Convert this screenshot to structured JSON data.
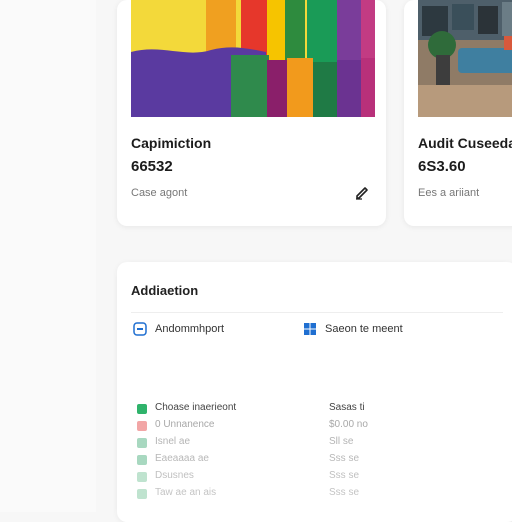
{
  "cards": [
    {
      "title": "Capimiction",
      "value": "66532",
      "subtitle": "Case agont"
    },
    {
      "title": "Audit Cuseeda",
      "value": "6S3.60",
      "subtitle": "Ees a ariiant"
    }
  ],
  "panel": {
    "title": "Addiaetion",
    "options": [
      {
        "label": "Andommhport",
        "icon": "toggle-icon"
      },
      {
        "label": "Saeon te meent",
        "icon": "grid-icon"
      }
    ],
    "rows": [
      {
        "name": "Choase inaerieont",
        "value": "Sasas ti",
        "color": "#2fb36b"
      },
      {
        "name": "0 Unnanence",
        "value": "$0.00 no",
        "color": "#f2a6a6"
      },
      {
        "name": "Isnel ae",
        "value": "Sll se",
        "color": "#a8d8c0"
      },
      {
        "name": "Eaeaaaa  ae",
        "value": "Sss se",
        "color": "#a8d8c0"
      },
      {
        "name": "Dsusnes",
        "value": "Sss se",
        "color": "#bfe3cf"
      },
      {
        "name": "Taw ae an ais",
        "value": "Sss se",
        "color": "#bfe3cf"
      }
    ]
  },
  "colors": {
    "accent_blue": "#1f6fd1",
    "green": "#2fb36b"
  }
}
